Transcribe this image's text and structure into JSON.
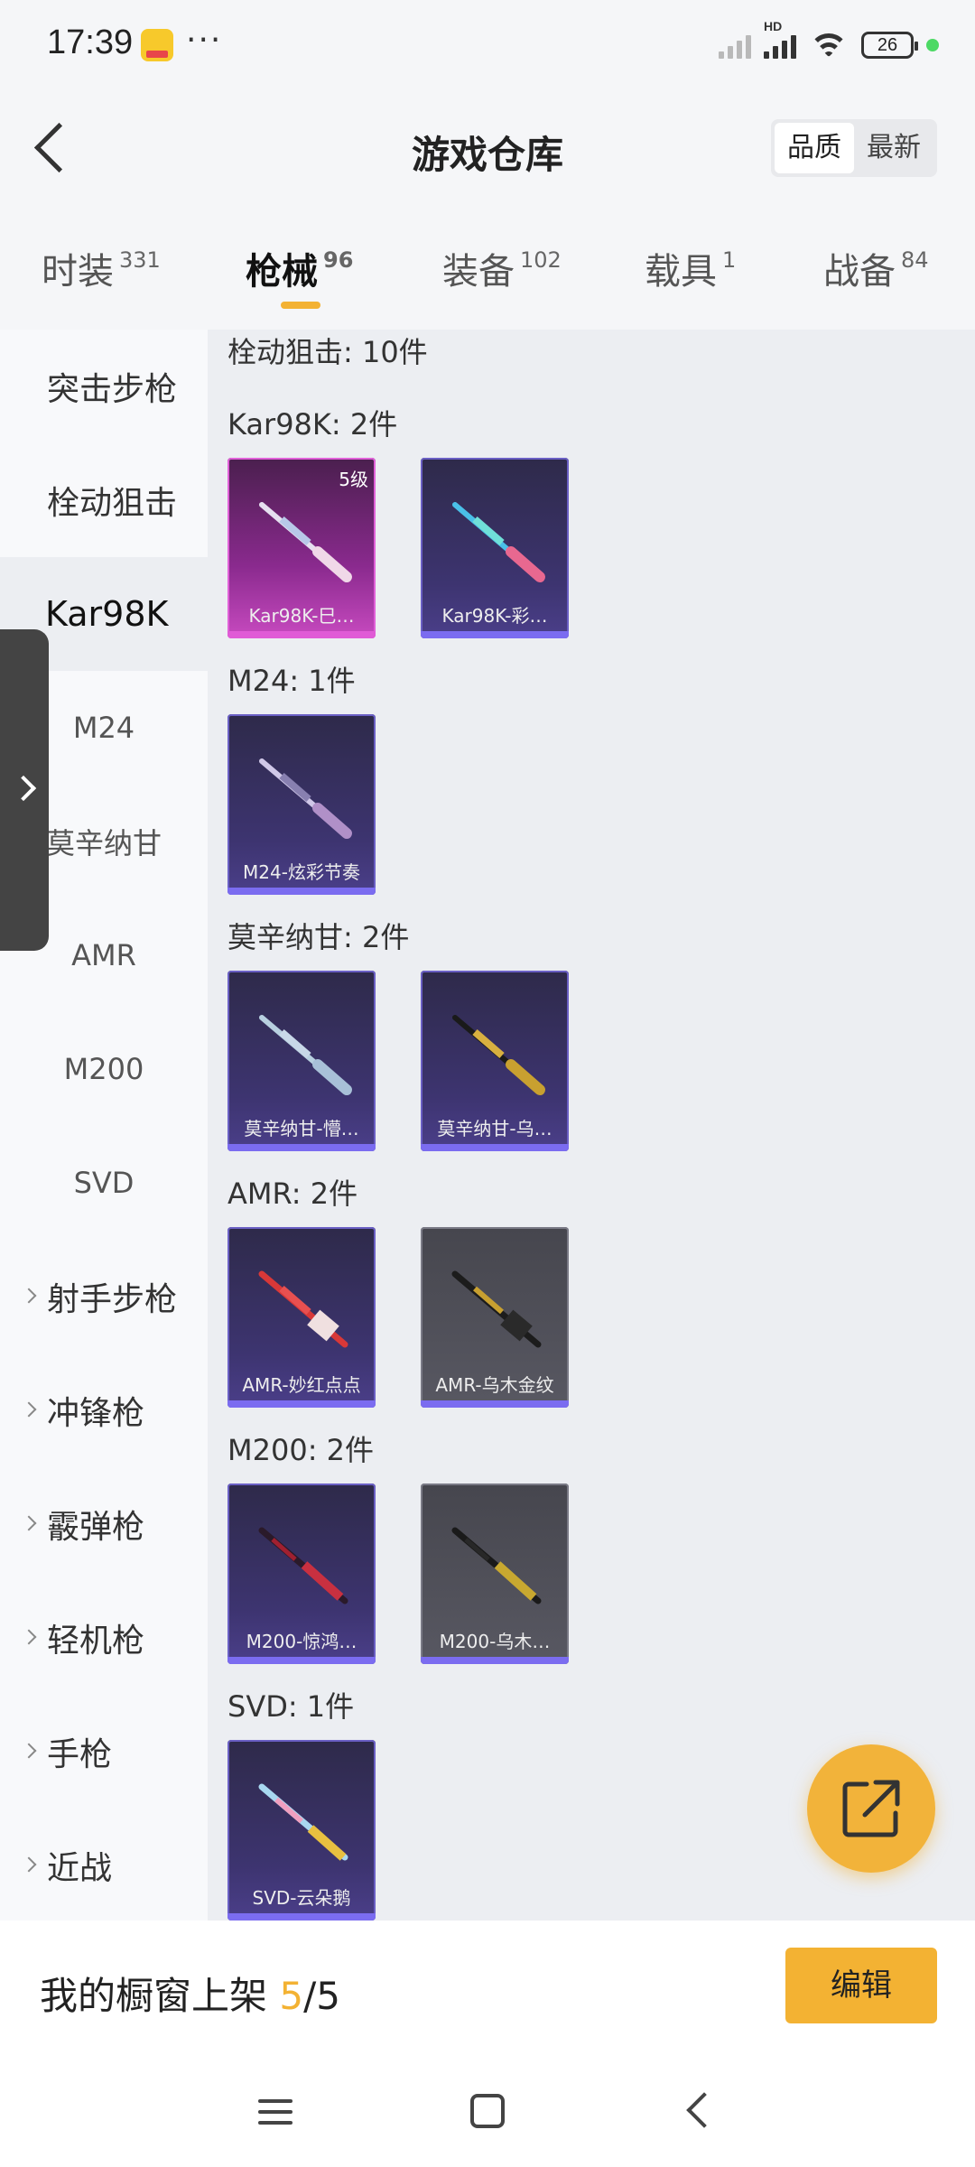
{
  "status_bar": {
    "time": "17:39",
    "dots": "···",
    "hd": "HD",
    "battery": "26"
  },
  "header": {
    "title": "游戏仓库",
    "sort": {
      "quality": "品质",
      "latest": "最新"
    }
  },
  "tabs": [
    {
      "label": "时装",
      "count": "331"
    },
    {
      "label": "枪械",
      "count": "96"
    },
    {
      "label": "装备",
      "count": "102"
    },
    {
      "label": "载具",
      "count": "1"
    },
    {
      "label": "战备",
      "count": "84"
    }
  ],
  "sidebar": {
    "items": [
      {
        "label": "突击步枪"
      },
      {
        "label": "栓动狙击"
      },
      {
        "label": "Kar98K"
      },
      {
        "label": "M24"
      },
      {
        "label": "莫辛纳甘"
      },
      {
        "label": "AMR"
      },
      {
        "label": "M200"
      },
      {
        "label": "SVD"
      },
      {
        "label": "射手步枪"
      },
      {
        "label": "冲锋枪"
      },
      {
        "label": "霰弹枪"
      },
      {
        "label": "轻机枪"
      },
      {
        "label": "手枪"
      },
      {
        "label": "近战"
      }
    ]
  },
  "main": {
    "section_title": "栓动狙击: 10件",
    "groups": [
      {
        "title": "Kar98K: 2件",
        "items": [
          {
            "name": "Kar98K-巳…",
            "level": "5级"
          },
          {
            "name": "Kar98K-彩…"
          }
        ]
      },
      {
        "title": "M24: 1件",
        "items": [
          {
            "name": "M24-炫彩节奏"
          }
        ]
      },
      {
        "title": "莫辛纳甘: 2件",
        "items": [
          {
            "name": "莫辛纳甘-懵…"
          },
          {
            "name": "莫辛纳甘-乌…"
          }
        ]
      },
      {
        "title": "AMR: 2件",
        "items": [
          {
            "name": "AMR-妙红点点"
          },
          {
            "name": "AMR-乌木金纹"
          }
        ]
      },
      {
        "title": "M200: 2件",
        "items": [
          {
            "name": "M200-惊鸿…"
          },
          {
            "name": "M200-乌木…"
          }
        ]
      },
      {
        "title": "SVD: 1件",
        "items": [
          {
            "name": "SVD-云朵鹅"
          }
        ]
      }
    ]
  },
  "bottom_bar": {
    "label": "我的橱窗上架 ",
    "current": "5",
    "total": "/5",
    "edit": "编辑"
  },
  "icons": {
    "back": "back-arrow-icon",
    "fab": "share-external-icon",
    "drawer": "chevron-right-icon"
  },
  "colors": {
    "accent": "#f3b233",
    "rare_purple": "#7b6cf0",
    "legendary_pink": "#e05bd6"
  }
}
